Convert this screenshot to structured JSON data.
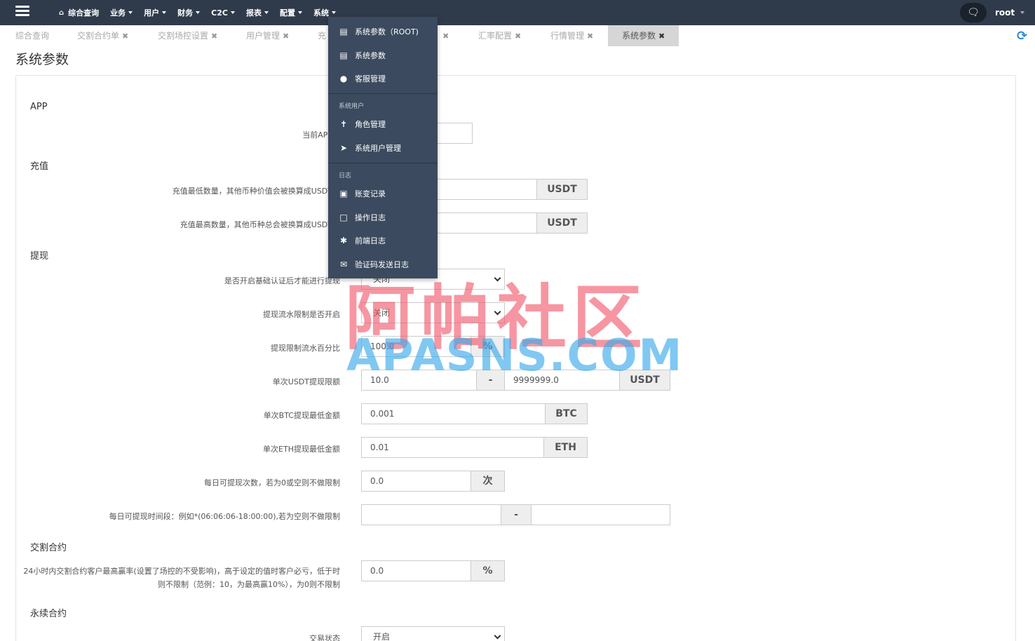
{
  "topnav": {
    "items": [
      "综合查询",
      "业务",
      "用户",
      "财务",
      "C2C",
      "报表",
      "配置",
      "系统"
    ],
    "user": "root"
  },
  "tabs": [
    "综合查询",
    "交割合约单",
    "交割场控设置",
    "用户管理",
    "充",
    "",
    "汇率配置",
    "行情管理",
    "系统参数"
  ],
  "page_title": "系统参数",
  "dropdown": {
    "items": [
      "系统参数（ROOT)",
      "系统参数",
      "客服管理",
      "角色管理",
      "系统用户管理",
      "账变记录",
      "操作日志",
      "前端日志",
      "验证码发送日志"
    ],
    "headers": [
      "系统用户",
      "日志"
    ]
  },
  "sections": {
    "app": "APP",
    "recharge": "充值",
    "withdraw": "提现",
    "delivery": "交割合约",
    "perpetual": "永续合约"
  },
  "labels": {
    "app_version": "当前APP版",
    "recharge_min": "充值最低数量，其他币种价值会被换算成USDT来",
    "recharge_max": "充值最高数量，其他币种总会被换算成USDT来",
    "withdraw_auth": "是否开启基础认证后才能进行提现",
    "withdraw_flow": "提现流水限制是否开启",
    "withdraw_flow_pct": "提现限制流水百分比",
    "usdt_limit": "单次USDT提现限额",
    "btc_min": "单次BTC提现最低金额",
    "eth_min": "单次ETH提现最低金额",
    "daily_count": "每日可提现次数，若为0或空则不做限制",
    "daily_time": "每日可提现时间段：例如*(06:06:06-18:00:00),若为空则不做限制",
    "delivery_rate": "24小时内交割合约客户最高赢率(设置了场控的不受影响)，高于设定的值时客户必亏，低于时则不限制（范例：10，为最高赢10%），为0则不限制",
    "trade_status": "交易状态"
  },
  "values": {
    "withdraw_auth": "关闭",
    "withdraw_flow": "关闭",
    "withdraw_flow_pct": "100.0",
    "usdt_min": "10.0",
    "usdt_max": "9999999.0",
    "btc_min": "0.001",
    "eth_min": "0.01",
    "daily_count": "0.0",
    "daily_time_start": "",
    "daily_time_end": "",
    "delivery_rate": "0.0",
    "trade_status": "开启"
  },
  "addons": {
    "usdt": "USDT",
    "btc": "BTC",
    "eth": "ETH",
    "percent": "%",
    "times": "次",
    "dash": "-"
  },
  "watermark": {
    "line1": "阿帕社区",
    "line2": "APASNS.COM"
  },
  "colors": {
    "topbar": "#2f3b4b",
    "dropdown": "#3b4a5e",
    "accent": "#2d8bd5"
  }
}
